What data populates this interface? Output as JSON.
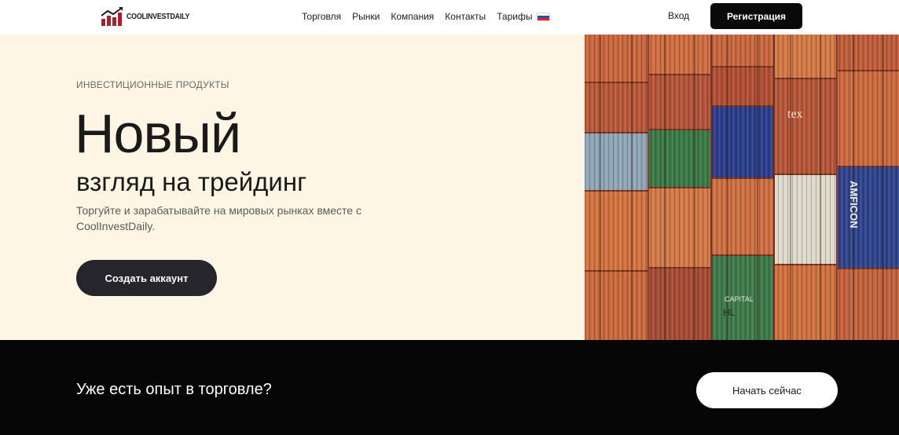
{
  "header": {
    "logo_text": "COOLINVESTDAILY",
    "nav": [
      "Торговля",
      "Рынки",
      "Компания",
      "Контакты",
      "Тарифы"
    ],
    "flag_colors": [
      "#ffffff",
      "#2a4bb0",
      "#d52b1e"
    ],
    "login_label": "Вход",
    "register_label": "Регистрация"
  },
  "hero": {
    "eyebrow": "ИНВЕСТИЦИОННЫЕ ПРОДУКТЫ",
    "headline": "Новый",
    "subheadline": "взгляд на трейдинг",
    "description": "Торгуйте и зарабатывайте на мировых рынках вместе с CoolInvestDaily.",
    "cta_label": "Создать аккаунт"
  },
  "image": {
    "container_labels": [
      "tex",
      "AMFICON",
      "CAPITAL",
      "HL"
    ]
  },
  "band": {
    "text": "Уже есть опыт в торговле?",
    "cta_label": "Начать сейчас"
  },
  "colors": {
    "hero_bg": "#fdf6e4",
    "dark": "#0a0a0a",
    "logo_red": "#a3232a"
  }
}
